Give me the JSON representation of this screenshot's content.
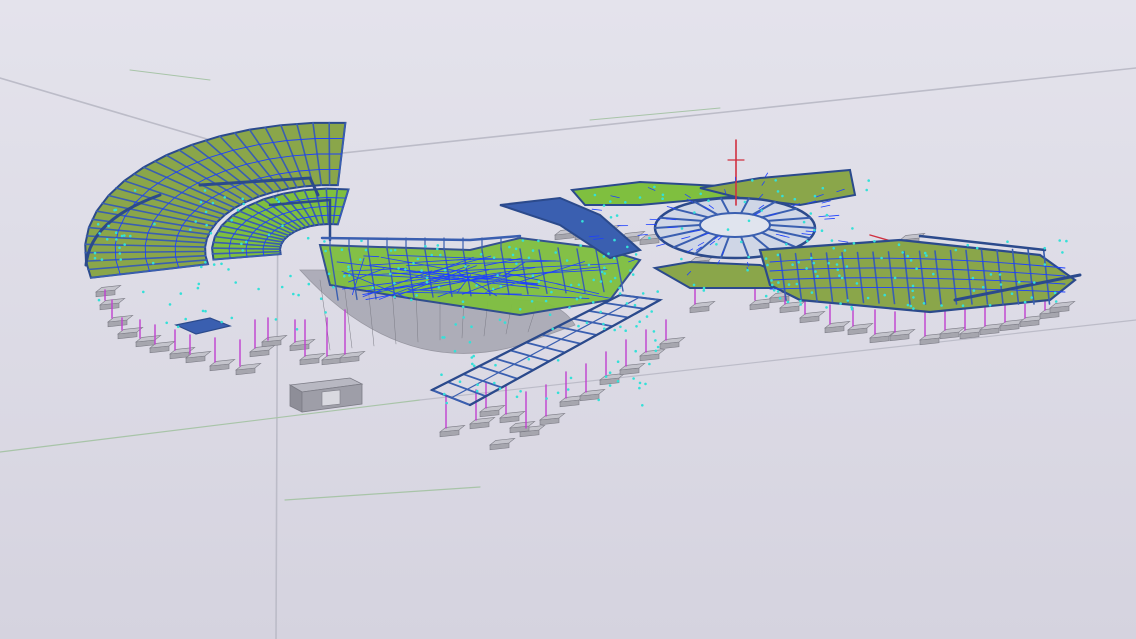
{
  "viewport": {
    "background_top": "#e4e3ec",
    "background_bottom": "#d5d3df"
  },
  "colors": {
    "grid_line": "#bcbcc8",
    "grid_line_green": "#a8c4a8",
    "beam_dark_blue": "#2b4a8c",
    "beam_mid_blue": "#3a5fb0",
    "deck_green": "#7fbf3f",
    "deck_olive": "#8aa64a",
    "bolt_cyan": "#34e0d8",
    "rebar_blue": "#1e40ff",
    "column_magenta": "#c040d0",
    "footing_gray": "#a6a6ae",
    "footing_dark": "#7c7c86",
    "slab_gray": "#9a9aa6",
    "mast_red": "#d03040"
  },
  "model": {
    "wings": [
      "west-curved-wing",
      "central-ring",
      "north-rotunda",
      "east-wing",
      "south-walkway"
    ]
  }
}
